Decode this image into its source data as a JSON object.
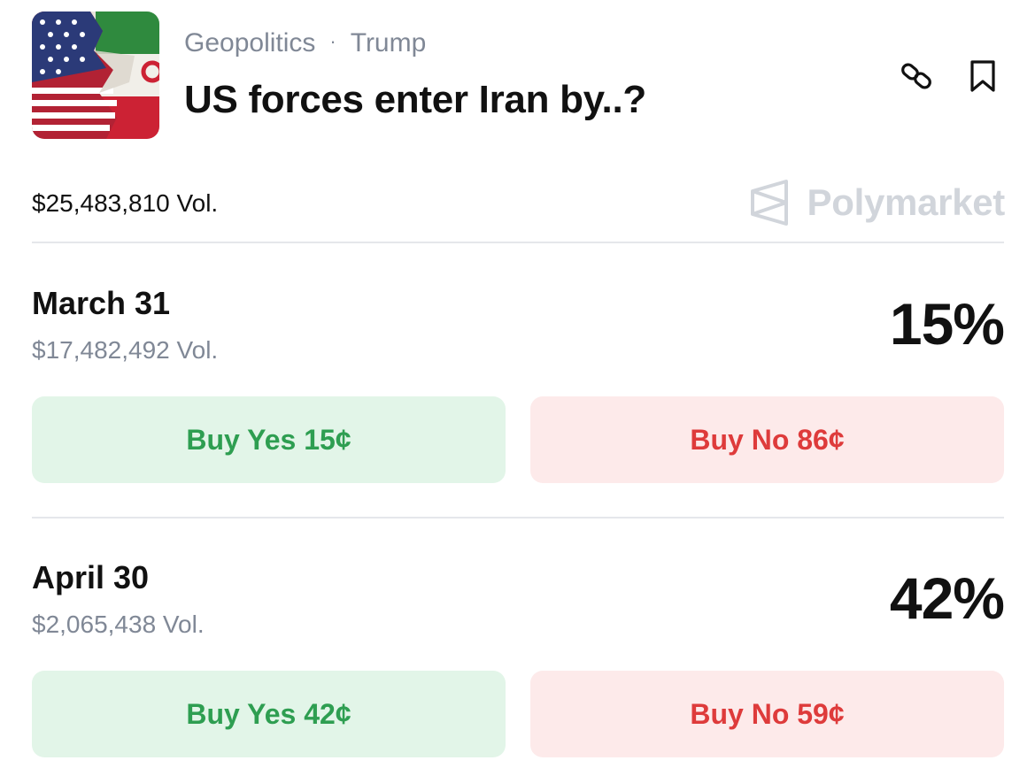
{
  "header": {
    "category": "Geopolitics",
    "separator": "·",
    "tag": "Trump",
    "title": "US forces enter Iran by..?",
    "thumbnail_icon": "us-iran-flag-image",
    "share_icon": "link-icon",
    "bookmark_icon": "bookmark-icon"
  },
  "summary": {
    "total_volume": "$25,483,810 Vol.",
    "brand_name": "Polymarket",
    "brand_icon": "polymarket-logo"
  },
  "markets": [
    {
      "date": "March 31",
      "volume": "$17,482,492 Vol.",
      "probability": "15%",
      "buy_yes": "Buy Yes 15¢",
      "buy_no": "Buy No 86¢"
    },
    {
      "date": "April 30",
      "volume": "$2,065,438 Vol.",
      "probability": "42%",
      "buy_yes": "Buy Yes 42¢",
      "buy_no": "Buy No 59¢"
    }
  ],
  "colors": {
    "yes_bg": "#e2f5e8",
    "yes_text": "#2e9e51",
    "no_bg": "#fdeaea",
    "no_text": "#de3b3b",
    "muted_text": "#808896",
    "brand_gray": "#d1d5db"
  }
}
